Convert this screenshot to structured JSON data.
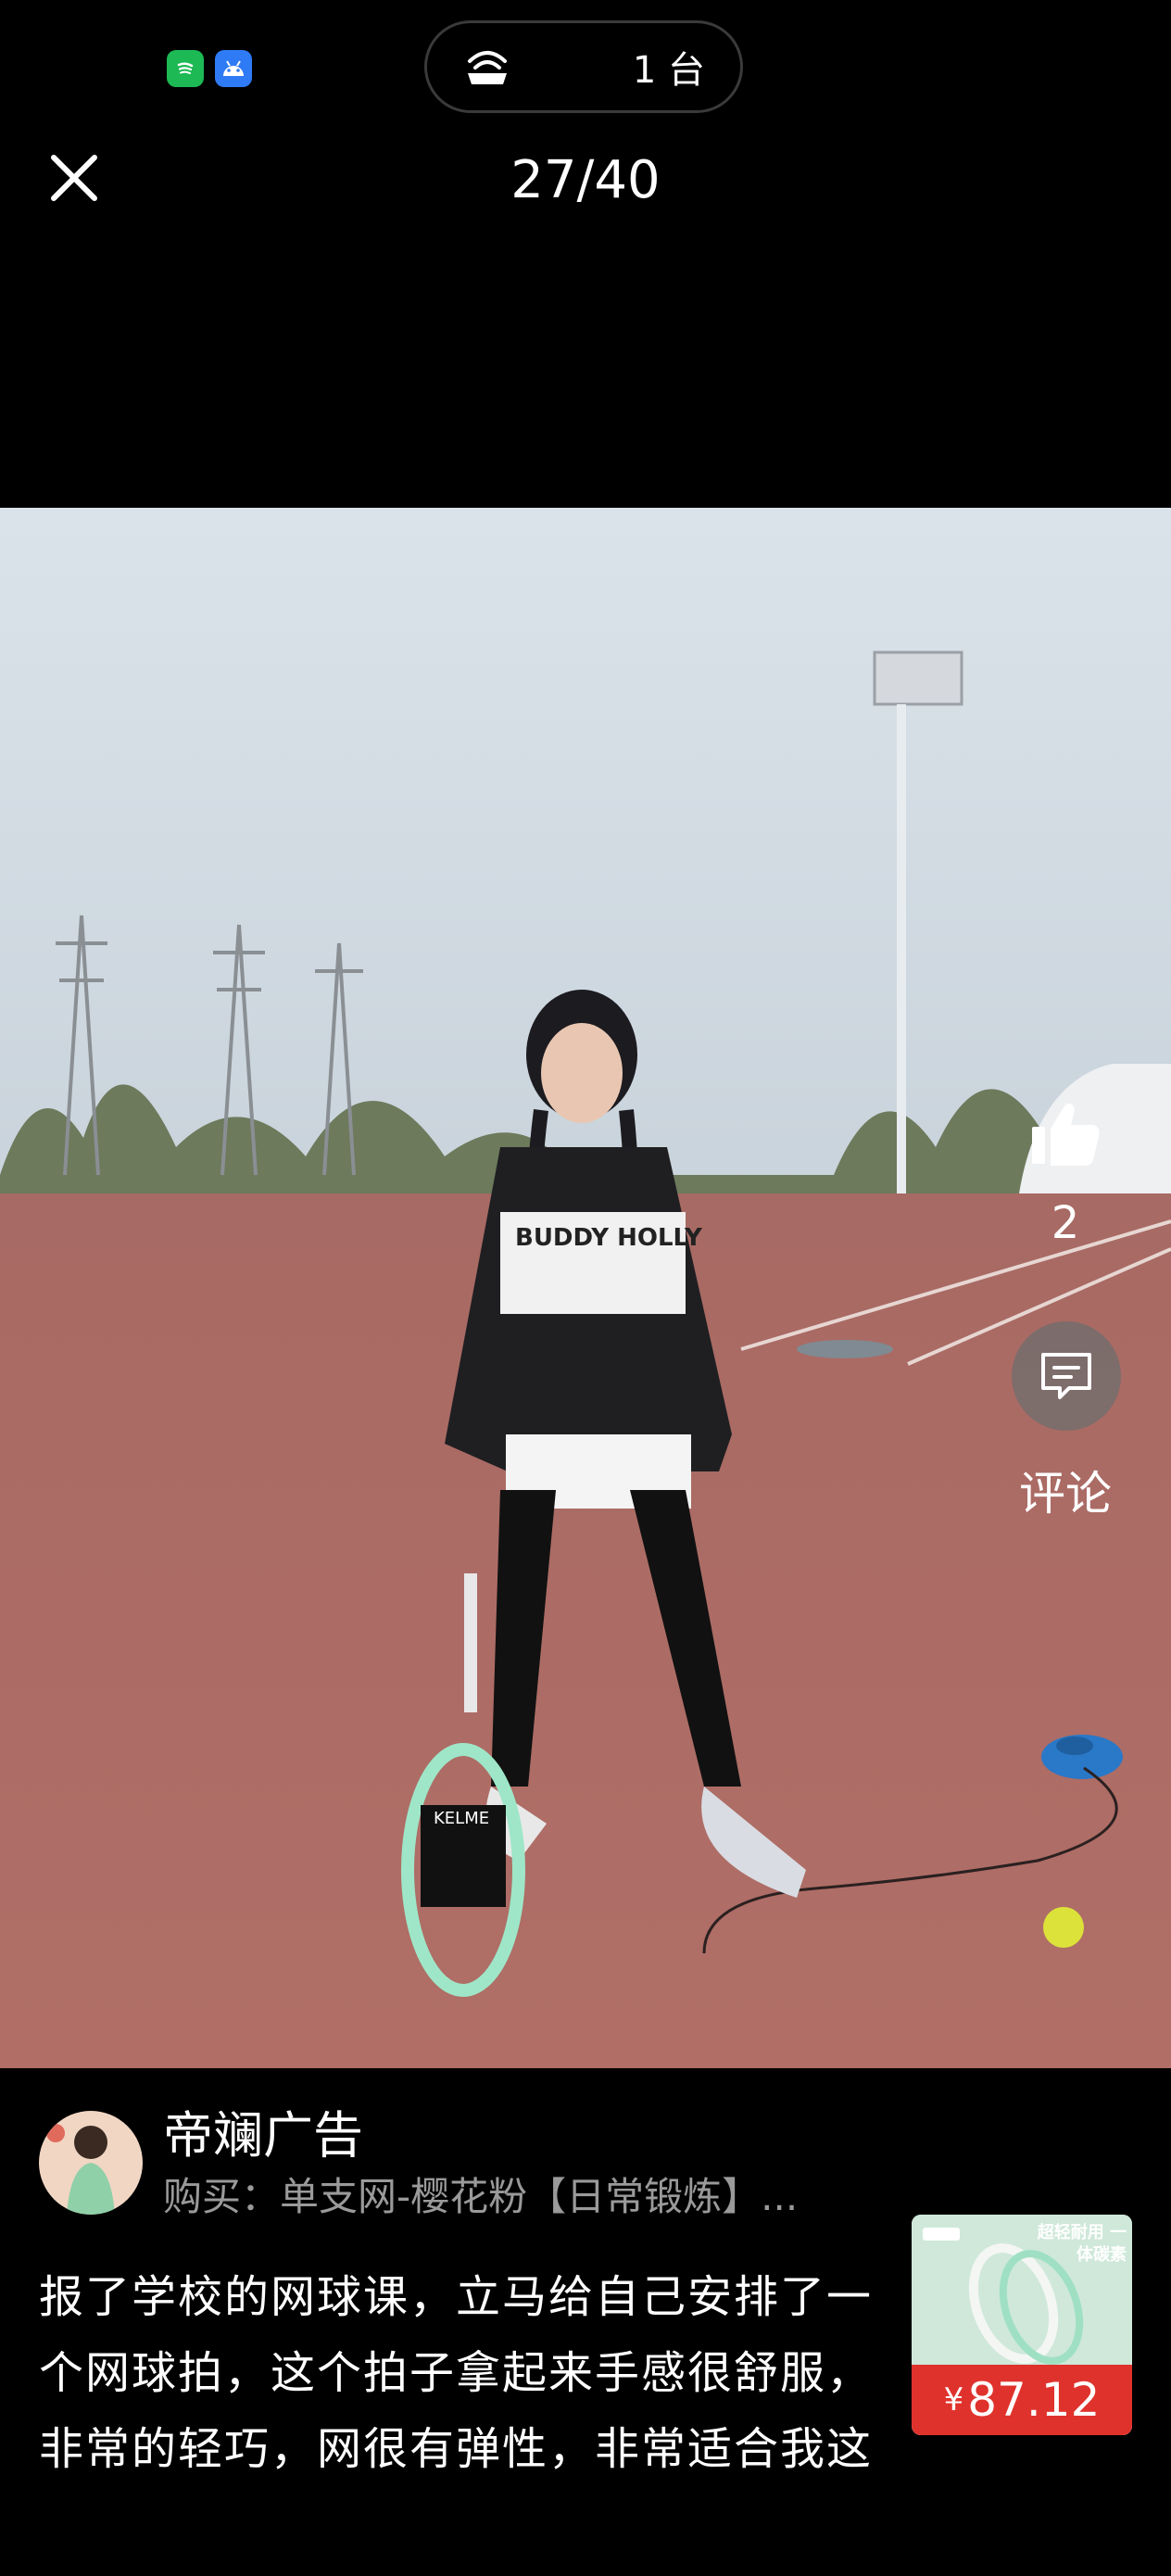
{
  "status_bar": {
    "apps": [
      {
        "icon": "spotify-icon",
        "color": "#1db954"
      },
      {
        "icon": "android-icon",
        "color": "#2f7bf6"
      }
    ],
    "cast_icon": "cast-device-icon",
    "cast_count": "1 台"
  },
  "header": {
    "close_icon": "close-icon",
    "counter": "27/40"
  },
  "actions": {
    "like_icon": "thumbs-up-icon",
    "like_count": "2",
    "comment_icon": "comment-icon",
    "comment_label": "评论"
  },
  "post": {
    "author": "帝斓广告",
    "buy_line": "购买：单支网-樱花粉【日常锻炼】...",
    "description": "报了学校的网球课，立马给自己安排了一个网球拍，这个拍子拿起来手感很舒服，非常的轻巧，网很有弹性，非常适合我这种新手"
  },
  "product": {
    "image_text": "超轻耐用 一体碳素",
    "currency": "¥",
    "price": "87.12"
  },
  "colors": {
    "background": "#000000",
    "price_red": "#e0322c",
    "secondary_text": "#9a9a9a"
  }
}
